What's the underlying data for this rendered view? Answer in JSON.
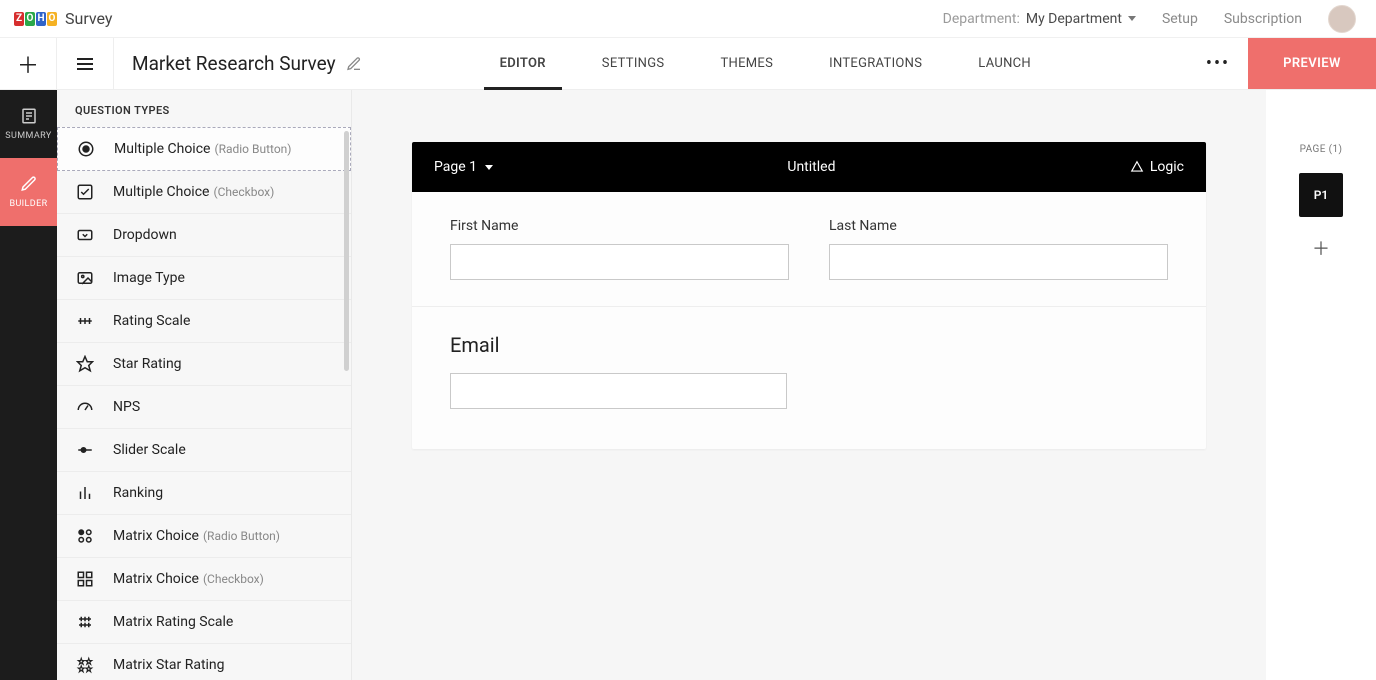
{
  "brand_text": "Survey",
  "header": {
    "department_label": "Department:",
    "department_value": "My Department",
    "setup": "Setup",
    "subscription": "Subscription"
  },
  "survey_title": "Market Research Survey",
  "tabs": [
    "EDITOR",
    "SETTINGS",
    "THEMES",
    "INTEGRATIONS",
    "LAUNCH"
  ],
  "active_tab": "EDITOR",
  "preview_label": "PREVIEW",
  "left_rail": {
    "summary": "SUMMARY",
    "builder": "BUILDER"
  },
  "sidebar": {
    "title": "QUESTION TYPES",
    "items": [
      {
        "label": "Multiple Choice",
        "sub": "(Radio Button)",
        "icon": "radio",
        "highlighted": true
      },
      {
        "label": "Multiple Choice",
        "sub": "(Checkbox)",
        "icon": "checkbox"
      },
      {
        "label": "Dropdown",
        "sub": "",
        "icon": "dropdown"
      },
      {
        "label": "Image Type",
        "sub": "",
        "icon": "image"
      },
      {
        "label": "Rating Scale",
        "sub": "",
        "icon": "rating"
      },
      {
        "label": "Star Rating",
        "sub": "",
        "icon": "star"
      },
      {
        "label": "NPS",
        "sub": "",
        "icon": "gauge"
      },
      {
        "label": "Slider Scale",
        "sub": "",
        "icon": "slider"
      },
      {
        "label": "Ranking",
        "sub": "",
        "icon": "ranking"
      },
      {
        "label": "Matrix Choice",
        "sub": "(Radio Button)",
        "icon": "matrix-radio"
      },
      {
        "label": "Matrix Choice",
        "sub": "(Checkbox)",
        "icon": "matrix-check"
      },
      {
        "label": "Matrix Rating Scale",
        "sub": "",
        "icon": "matrix-rating"
      },
      {
        "label": "Matrix Star Rating",
        "sub": "",
        "icon": "matrix-star"
      }
    ]
  },
  "page_header": {
    "page_label": "Page 1",
    "title": "Untitled",
    "logic_label": "Logic"
  },
  "questions": {
    "first_name": "First Name",
    "last_name": "Last Name",
    "email": "Email"
  },
  "pages_rail": {
    "label": "PAGE (1)",
    "thumb": "P1"
  }
}
